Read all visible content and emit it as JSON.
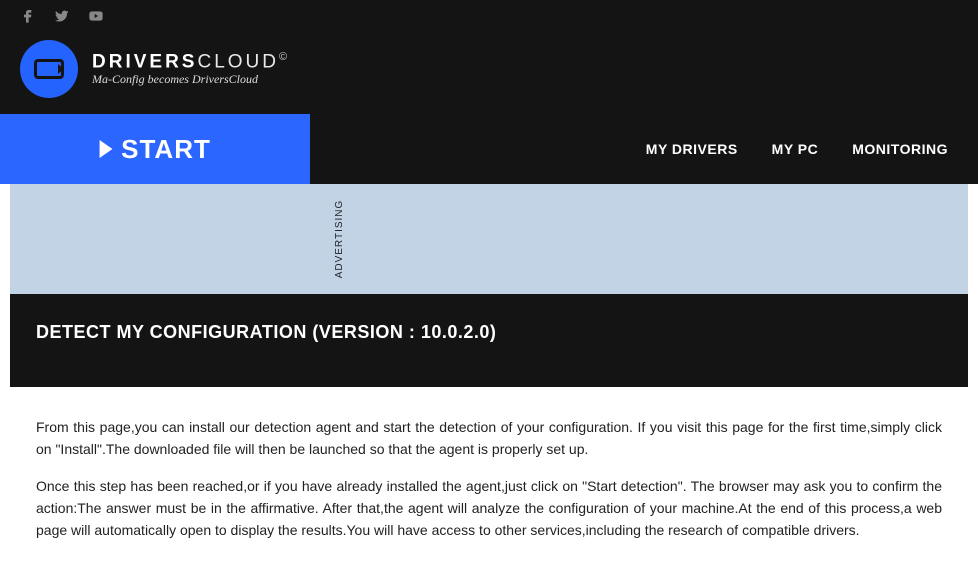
{
  "social": {
    "facebook": "facebook-icon",
    "twitter": "twitter-icon",
    "youtube": "youtube-icon"
  },
  "brand": {
    "name_bold": "DRIVERS",
    "name_light": "CLOUD",
    "reg": "©",
    "tagline": "Ma-Config becomes DriversCloud"
  },
  "nav": {
    "start": "START",
    "my_drivers": "MY DRIVERS",
    "my_pc": "MY PC",
    "monitoring": "MONITORING"
  },
  "ad_label": "ADVERTISING",
  "page_title": "DETECT MY CONFIGURATION (VERSION : 10.0.2.0)",
  "content": {
    "p1": "From this page,you can install our detection agent and start the detection of your configuration. If you visit this page for the first time,simply click on \"Install\".The downloaded file will then be launched so that the agent is properly set up.",
    "p2": "Once this step has been reached,or if you have already installed the agent,just click on \"Start detection\". The browser may ask you to confirm the action:The answer must be in the affirmative. After that,the agent will analyze the configuration of your machine.At the end of this process,a web page will automatically open to display the results.You will have access to other services,including the research of compatible drivers."
  }
}
